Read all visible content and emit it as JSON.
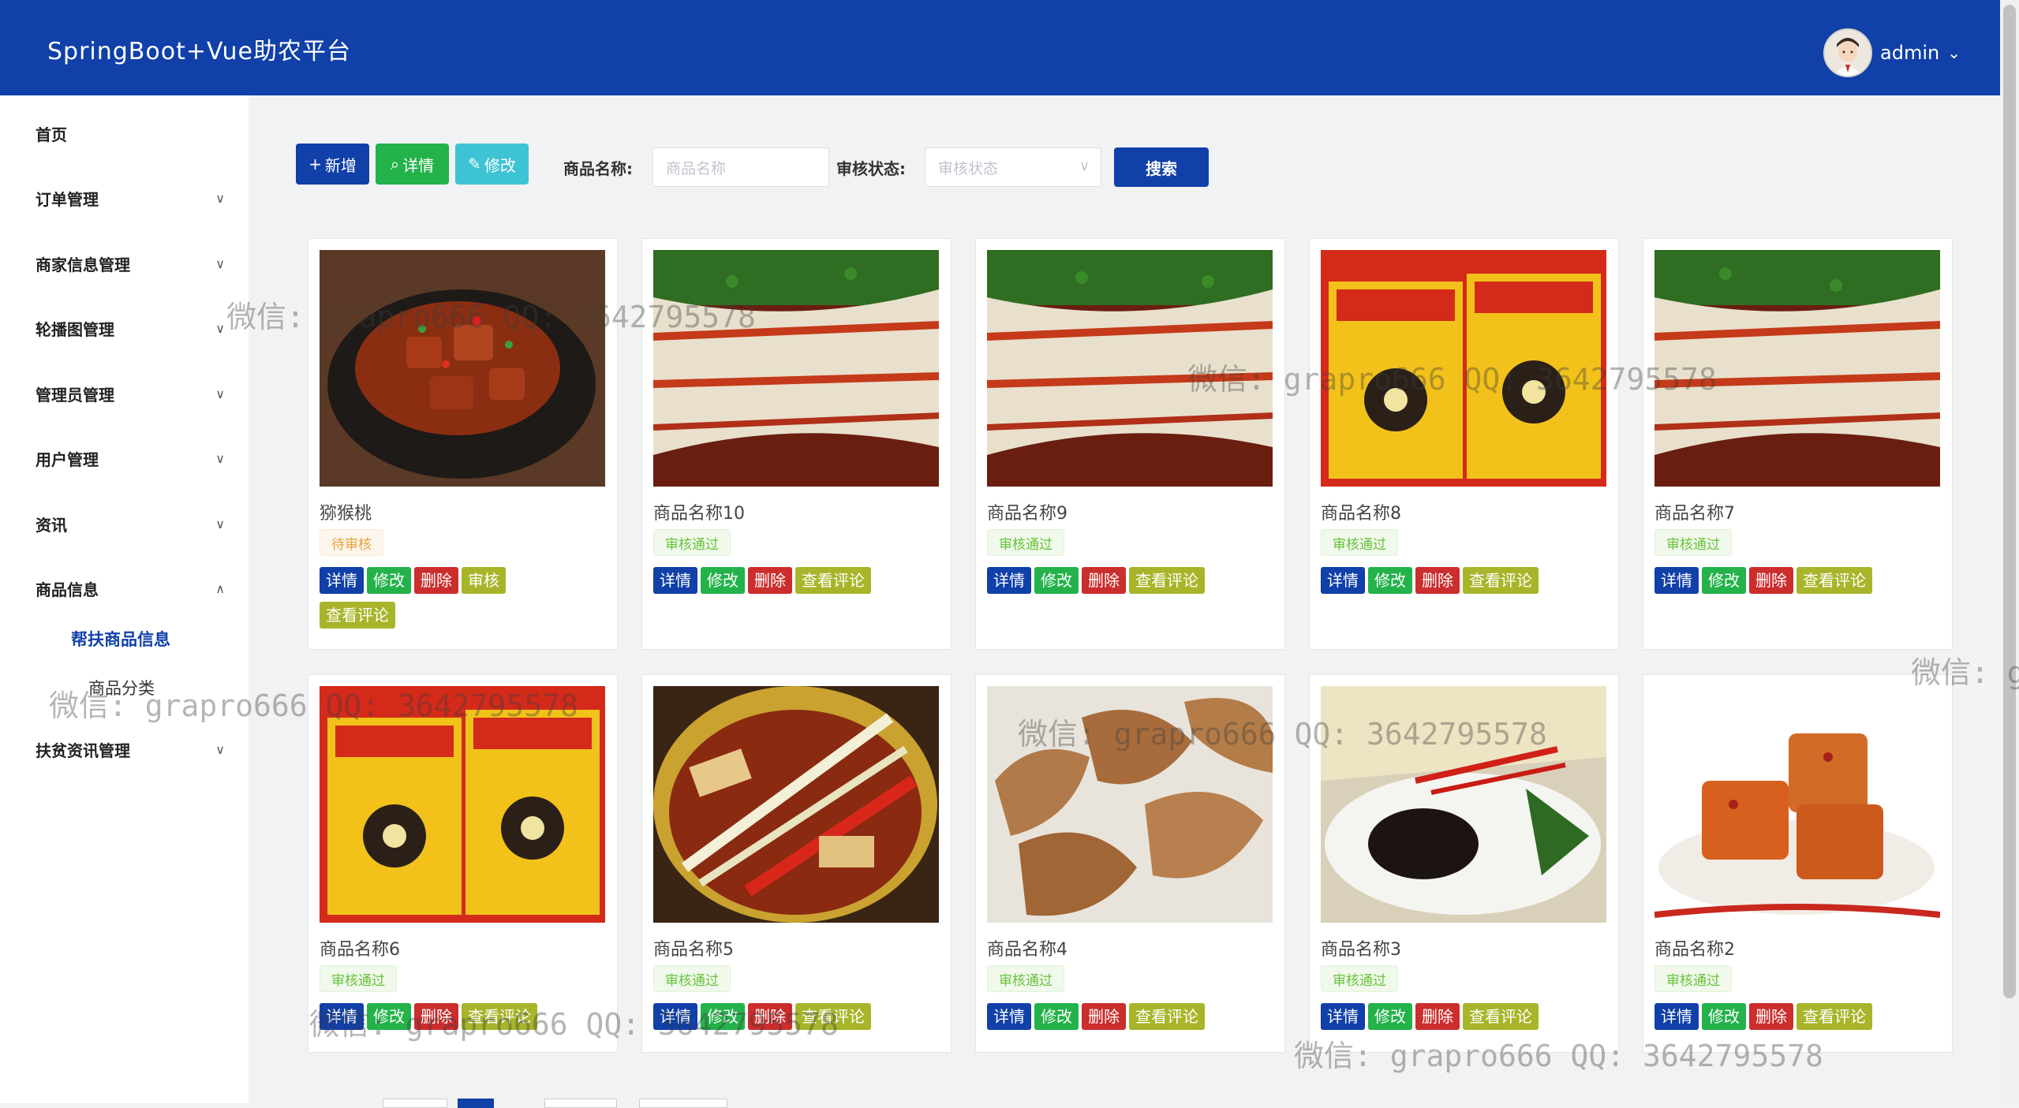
{
  "header": {
    "title": "SpringBoot+Vue助农平台",
    "user_name": "admin"
  },
  "sidebar": {
    "items": [
      {
        "label": "首页"
      },
      {
        "label": "订单管理"
      },
      {
        "label": "商家信息管理"
      },
      {
        "label": "轮播图管理"
      },
      {
        "label": "管理员管理"
      },
      {
        "label": "用户管理"
      },
      {
        "label": "资讯"
      },
      {
        "label": "商品信息"
      },
      {
        "label": "扶贫资讯管理"
      }
    ],
    "sub_items": [
      {
        "label": "帮扶商品信息"
      },
      {
        "label": "商品分类"
      }
    ]
  },
  "toolbar": {
    "add_label": "新增",
    "detail_label": "详情",
    "edit_label": "修改",
    "name_label": "商品名称:",
    "name_placeholder": "商品名称",
    "status_label": "审核状态:",
    "status_placeholder": "审核状态",
    "search_label": "搜索"
  },
  "actions": {
    "detail": "详情",
    "edit": "修改",
    "delete": "删除",
    "audit": "审核",
    "comments": "查看评论"
  },
  "products": [
    {
      "name": "猕猴桃",
      "status": "待审核"
    },
    {
      "name": "商品名称10",
      "status": "审核通过"
    },
    {
      "name": "商品名称9",
      "status": "审核通过"
    },
    {
      "name": "商品名称8",
      "status": "审核通过"
    },
    {
      "name": "商品名称7",
      "status": "审核通过"
    },
    {
      "name": "商品名称6",
      "status": "审核通过"
    },
    {
      "name": "商品名称5",
      "status": "审核通过"
    },
    {
      "name": "商品名称4",
      "status": "审核通过"
    },
    {
      "name": "商品名称3",
      "status": "审核通过"
    },
    {
      "name": "商品名称2",
      "status": "审核通过"
    }
  ],
  "watermarks": {
    "w1": "微信: grapro666 QQ: 3642795578",
    "w2": "微信: grapro666 QQ: 3642795578",
    "w3": "微信: grapro666 QQ: 3642795578",
    "w4": "微信: grapro666 QQ: 3642795578",
    "w5": "微信: grapro666 QQ: 3642795578",
    "w6": "微信: grapro666 QQ: 3642795578",
    "w7": "微信: g"
  },
  "colors": {
    "header": "#1040a8",
    "primary": "#1040a8",
    "success": "#24b24a",
    "danger": "#cc2d2d",
    "olive": "#a8b52a",
    "cyan": "#3ec3d4"
  }
}
